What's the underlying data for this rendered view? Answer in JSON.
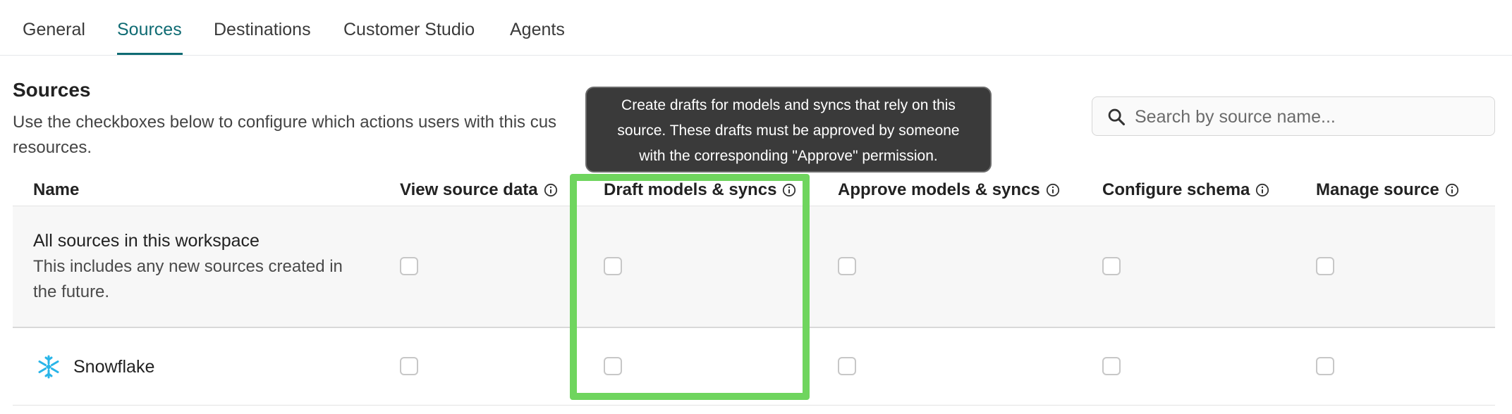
{
  "tabs": [
    {
      "label": "General",
      "active": false
    },
    {
      "label": "Sources",
      "active": true
    },
    {
      "label": "Destinations",
      "active": false
    },
    {
      "label": "Customer Studio",
      "active": false
    },
    {
      "label": "Agents",
      "active": false
    }
  ],
  "section": {
    "title": "Sources",
    "description_line1": "Use the checkboxes below to configure which actions users with this cus",
    "description_line2": "resources."
  },
  "search": {
    "placeholder": "Search by source name..."
  },
  "tooltip": {
    "line1": "Create drafts for models and syncs that rely on this",
    "line2": "source. These drafts must be approved by someone",
    "line3": "with the corresponding \"Approve\" permission."
  },
  "table": {
    "columns": [
      {
        "label": "Name",
        "has_info": false
      },
      {
        "label": "View source data",
        "has_info": true
      },
      {
        "label": "Draft models & syncs",
        "has_info": true
      },
      {
        "label": "Approve models & syncs",
        "has_info": true
      },
      {
        "label": "Configure schema",
        "has_info": true
      },
      {
        "label": "Manage source",
        "has_info": true
      }
    ],
    "rows": [
      {
        "title": "All sources in this workspace",
        "subtitle": "This includes any new sources created in the future.",
        "checked": [
          false,
          false,
          false,
          false,
          false
        ]
      },
      {
        "title": "Snowflake",
        "icon": "snowflake-icon",
        "checked": [
          false,
          false,
          false,
          false,
          false
        ]
      }
    ]
  },
  "colors": {
    "accent": "#0f6b73",
    "highlight": "#6fd55e",
    "tooltip_bg": "#3a3a3a",
    "snowflake": "#29b5e8"
  }
}
